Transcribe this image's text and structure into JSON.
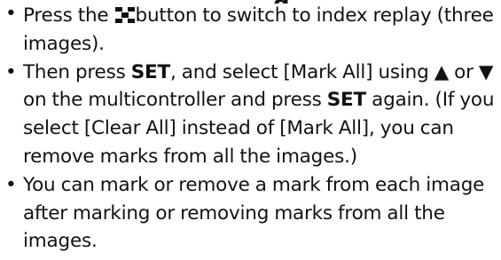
{
  "items": [
    {
      "text_before": "Press the",
      "icon": "index-replay-icon",
      "text_after": "button to switch to index replay (three images)."
    },
    {
      "text_1": "Then press",
      "set_1": "SET",
      "text_2": ", and select [Mark All] using",
      "up_arrow": "▲",
      "text_3": "or",
      "down_arrow": "▼",
      "text_4": "on the multicontroller and press",
      "set_2": "SET",
      "text_5": "again. (If you select [Clear All] instead of [Mark All], you can remove marks from all the images.)"
    },
    {
      "text": "You can mark or remove a mark from each image after marking or removing marks from all the images."
    }
  ],
  "bullet": "•"
}
